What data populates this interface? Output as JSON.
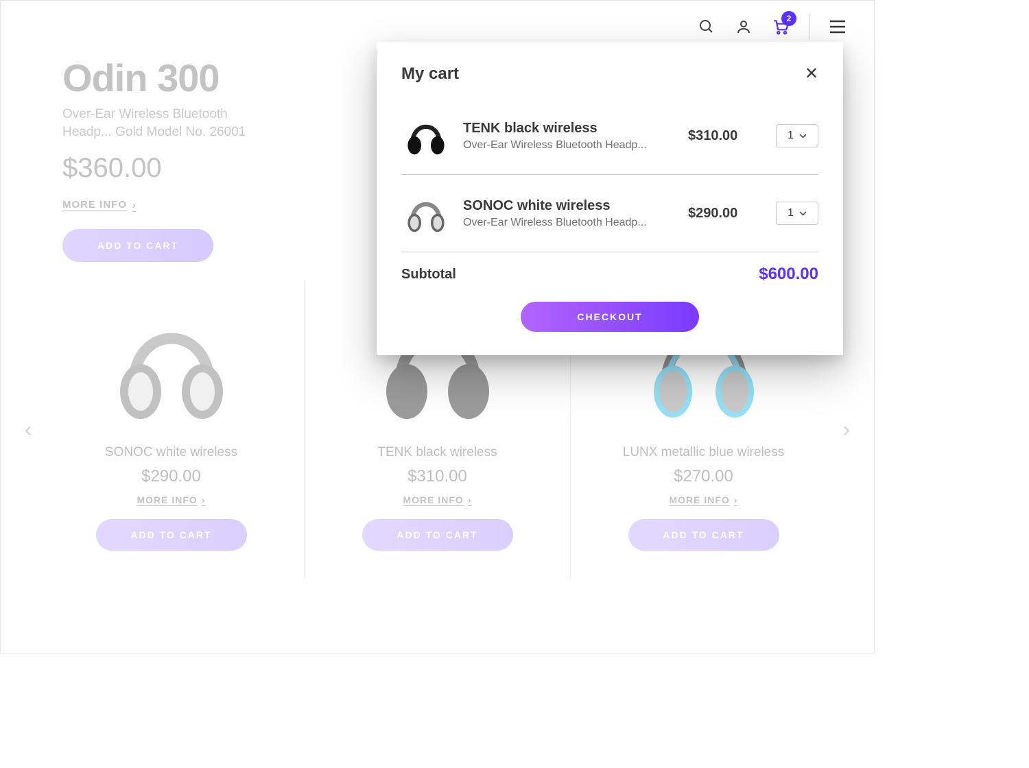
{
  "topbar": {
    "cart_count": "2"
  },
  "hero": {
    "title": "Odin 300",
    "subtitle": "Over-Ear Wireless Bluetooth Headp... Gold Model No. 26001",
    "price": "$360.00",
    "more": "MORE INFO",
    "add": "ADD TO CART"
  },
  "carousel": {
    "more": "MORE INFO",
    "add": "ADD TO CART",
    "items": [
      {
        "name": "SONOC white wireless",
        "price": "$290.00"
      },
      {
        "name": "TENK black wireless",
        "price": "$310.00"
      },
      {
        "name": "LUNX metallic blue wireless",
        "price": "$270.00"
      }
    ]
  },
  "cart": {
    "title": "My cart",
    "rows": [
      {
        "name": "TENK black wireless",
        "desc": "Over-Ear Wireless Bluetooth Headp...",
        "price": "$310.00",
        "qty": "1"
      },
      {
        "name": "SONOC white wireless",
        "desc": "Over-Ear Wireless Bluetooth Headp...",
        "price": "$290.00",
        "qty": "1"
      }
    ],
    "subtotal_label": "Subtotal",
    "subtotal": "$600.00",
    "checkout": "CHECKOUT"
  }
}
